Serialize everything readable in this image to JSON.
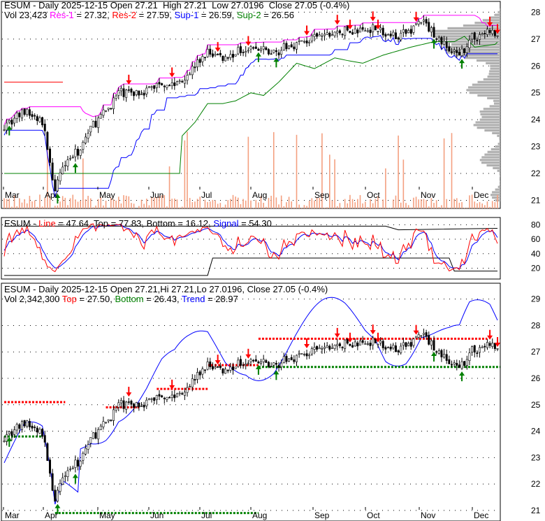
{
  "chart_data": [
    {
      "type": "candlestick",
      "title": "ESUM - Daily 2025-12-15 Open 27.21 High 27.21 Low 27.0196 Close 27.05 (-0.4%)",
      "header": {
        "ticker": "ESUM",
        "sep": " - ",
        "period": "Daily 2025-12-15",
        "open": "Open 27.21",
        "high": "High 27.21",
        "low": "Low 27.0196",
        "close": "Close 27.05 (-0.4%)"
      },
      "legend": {
        "vol": "Vol 23,423",
        "res1_label": "Res-1",
        "res1": " = 27.32, ",
        "res2_label": "Res-2",
        "res2": " = 27.59, ",
        "sup1_label": "Sup-1",
        "sup1": " = 26.59, ",
        "sup2_label": "Sup-2",
        "sup2": " = 26.56"
      },
      "x_ticks": [
        "Mar",
        "Apr",
        "May",
        "Jun",
        "Jul",
        "Aug",
        "Sep",
        "Oct",
        "Nov",
        "Dec"
      ],
      "y_ticks": [
        "28",
        "27",
        "26",
        "25",
        "24",
        "23",
        "22",
        "21"
      ],
      "ylim": [
        20.7,
        28.4
      ],
      "close_keypoints": [
        [
          0,
          23.8
        ],
        [
          8,
          24.3
        ],
        [
          15,
          23.9
        ],
        [
          18,
          22.5
        ],
        [
          20,
          21.2
        ],
        [
          23,
          22.4
        ],
        [
          29,
          22.8
        ],
        [
          34,
          23.7
        ],
        [
          40,
          24.3
        ],
        [
          45,
          25.0
        ],
        [
          51,
          25.0
        ],
        [
          56,
          25.1
        ],
        [
          62,
          25.4
        ],
        [
          67,
          25.3
        ],
        [
          73,
          25.8
        ],
        [
          80,
          26.5
        ],
        [
          87,
          26.3
        ],
        [
          95,
          26.7
        ],
        [
          100,
          26.6
        ],
        [
          106,
          26.5
        ],
        [
          114,
          26.8
        ],
        [
          125,
          27.1
        ],
        [
          134,
          27.3
        ],
        [
          142,
          27.3
        ],
        [
          146,
          27.5
        ],
        [
          150,
          27.1
        ],
        [
          158,
          27.2
        ],
        [
          164,
          27.7
        ],
        [
          169,
          27.2
        ],
        [
          175,
          26.6
        ],
        [
          179,
          26.3
        ],
        [
          183,
          27.0
        ],
        [
          191,
          27.3
        ],
        [
          194,
          27.05
        ]
      ],
      "sell_signals": [
        49,
        66,
        84,
        96,
        119,
        131,
        136,
        145,
        147,
        162,
        191,
        194
      ],
      "buy_signals": [
        2,
        21,
        28,
        100,
        107,
        169,
        180
      ]
    },
    {
      "type": "line",
      "header": {
        "ticker": "ESUM - ",
        "line_label": "Line",
        "line": " = 47.64, Top = 77.83, Bottom = 16.12, ",
        "signal_label": "Signal",
        "signal": " = 54.30"
      },
      "y_ticks": [
        "80",
        "60",
        "40",
        "20"
      ],
      "ylim": [
        5,
        90
      ]
    },
    {
      "type": "candlestick",
      "header": {
        "title": "ESUM - Daily 2025-12-15 Open 27.21,Hi 27.21,Lo 27.0196, Close 27.05 (-0.4%)",
        "vol": "Vol 2,342,300 ",
        "top_label": "Top",
        "top": " = 27.50, ",
        "bottom_label": "Bottom",
        "bottom": " = 26.43, ",
        "trend_label": "Trend",
        "trend": " = 28.97"
      },
      "x_ticks": [
        "Mar",
        "Apr",
        "May",
        "Jun",
        "Jul",
        "Aug",
        "Sep",
        "Oct",
        "Nov",
        "Dec"
      ],
      "y_ticks": [
        "29",
        "28",
        "27",
        "26",
        "25",
        "24",
        "23",
        "22",
        "21"
      ],
      "ylim": [
        20.6,
        29.6
      ]
    }
  ]
}
